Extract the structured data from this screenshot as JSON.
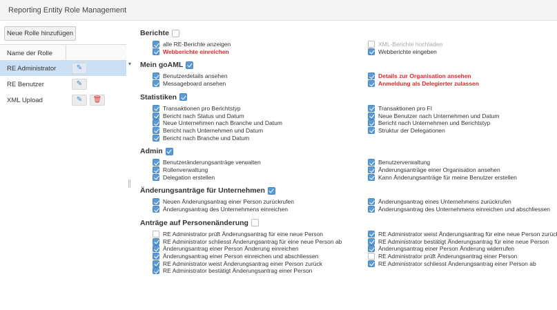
{
  "window": {
    "title": "Reporting Entity Role Management"
  },
  "left": {
    "add_button": "Neue Rolle hinzufügen",
    "column_header": "Name der Rolle",
    "roles": [
      {
        "name": "RE Administrator",
        "selected": true,
        "deletable": false
      },
      {
        "name": "RE Benutzer",
        "selected": false,
        "deletable": false
      },
      {
        "name": "XML Upload",
        "selected": false,
        "deletable": true
      }
    ]
  },
  "sections": [
    {
      "title": "Berichte",
      "checked": false,
      "left": [
        {
          "label": "alle RE-Berichte anzeigen",
          "checked": true,
          "style": "normal"
        },
        {
          "label": "Webberichte einreichen",
          "checked": true,
          "style": "red"
        }
      ],
      "right": [
        {
          "label": "XML-Berichte hochladen",
          "checked": false,
          "style": "muted"
        },
        {
          "label": "Webberichte eingeben",
          "checked": true,
          "style": "normal"
        }
      ]
    },
    {
      "title": "Mein goAML",
      "checked": true,
      "left": [
        {
          "label": "Benutzerdetails ansehen",
          "checked": true,
          "style": "normal"
        },
        {
          "label": "Messageboard ansehen",
          "checked": true,
          "style": "normal"
        }
      ],
      "right": [
        {
          "label": "Details zur Organisation ansehen",
          "checked": true,
          "style": "red"
        },
        {
          "label": "Anmeldung als Delegierter zulassen",
          "checked": true,
          "style": "red"
        }
      ]
    },
    {
      "title": "Statistiken",
      "checked": true,
      "left": [
        {
          "label": "Transaktionen pro Berichtstyp",
          "checked": true,
          "style": "normal"
        },
        {
          "label": "Bericht nach Status und Datum",
          "checked": true,
          "style": "normal"
        },
        {
          "label": "Neue Unternehmen nach Branche und Datum",
          "checked": true,
          "style": "normal"
        },
        {
          "label": "Bericht nach Unternehmen und Datum",
          "checked": true,
          "style": "normal"
        },
        {
          "label": "Bericht nach Branche und Datum",
          "checked": true,
          "style": "normal"
        }
      ],
      "right": [
        {
          "label": "Transaktionen pro FI",
          "checked": true,
          "style": "normal"
        },
        {
          "label": "Neue Benutzer nach Unternehmen und Datum",
          "checked": true,
          "style": "normal"
        },
        {
          "label": "Bericht nach Unternehmen und Berichtstyp",
          "checked": true,
          "style": "normal"
        },
        {
          "label": "Struktur der Delegationen",
          "checked": true,
          "style": "normal"
        }
      ]
    },
    {
      "title": "Admin",
      "checked": true,
      "left": [
        {
          "label": "Benutzeränderungsanträge verwalten",
          "checked": true,
          "style": "normal"
        },
        {
          "label": "Rollenverwaltung",
          "checked": true,
          "style": "normal"
        },
        {
          "label": "Delegation erstellen",
          "checked": true,
          "style": "normal"
        }
      ],
      "right": [
        {
          "label": "Benutzerverwaltung",
          "checked": true,
          "style": "normal"
        },
        {
          "label": "Änderungsanträge einer Organisation ansehen",
          "checked": true,
          "style": "normal"
        },
        {
          "label": "Kann Änderungsanträge für meine Benutzer erstellen",
          "checked": true,
          "style": "normal"
        }
      ]
    },
    {
      "title": "Änderungsanträge für Unternehmen",
      "checked": true,
      "left": [
        {
          "label": "Neuen Änderungsantrag einer Person zurückrufen",
          "checked": true,
          "style": "normal"
        },
        {
          "label": "Änderungsantrag des Unternehmens einreichen",
          "checked": true,
          "style": "normal"
        }
      ],
      "right": [
        {
          "label": "Änderungsantrag eines Unternehmens zurückrufen",
          "checked": true,
          "style": "normal"
        },
        {
          "label": "Änderungsantrag des Unternehmens einreichen und abschliessen",
          "checked": true,
          "style": "normal"
        }
      ]
    },
    {
      "title": "Anträge auf Personenänderung",
      "checked": false,
      "left": [
        {
          "label": "RE Administrator prüft Änderungsantrag für eine neue Person",
          "checked": false,
          "style": "normal"
        },
        {
          "label": "RE Administrator schliesst Änderungsantrag für eine neue Person ab",
          "checked": true,
          "style": "normal"
        },
        {
          "label": "Änderungsantrag einer Person Änderung einreichen",
          "checked": true,
          "style": "normal"
        },
        {
          "label": "Änderungsantrag einer Person einreichen und abschliessen",
          "checked": true,
          "style": "normal"
        },
        {
          "label": "RE Administrator weist Änderungsantrag einer Person zurück",
          "checked": true,
          "style": "normal"
        },
        {
          "label": "RE Administrator bestätigt Änderungsantrag einer Person",
          "checked": true,
          "style": "normal"
        }
      ],
      "right": [
        {
          "label": "RE Administrator weist Änderungsantrag für eine neue Person zurück",
          "checked": true,
          "style": "normal"
        },
        {
          "label": "RE Administrator bestätigt Änderungsantrag für eine neue Person",
          "checked": true,
          "style": "normal"
        },
        {
          "label": "Änderungsantrag einer Person Änderung widerrufen",
          "checked": true,
          "style": "normal"
        },
        {
          "label": "RE Administrator prüft Änderungsantrag einer Person",
          "checked": false,
          "style": "normal"
        },
        {
          "label": "RE Administrator schliesst Änderungsantrag einer Person ab",
          "checked": true,
          "style": "normal"
        }
      ]
    }
  ]
}
